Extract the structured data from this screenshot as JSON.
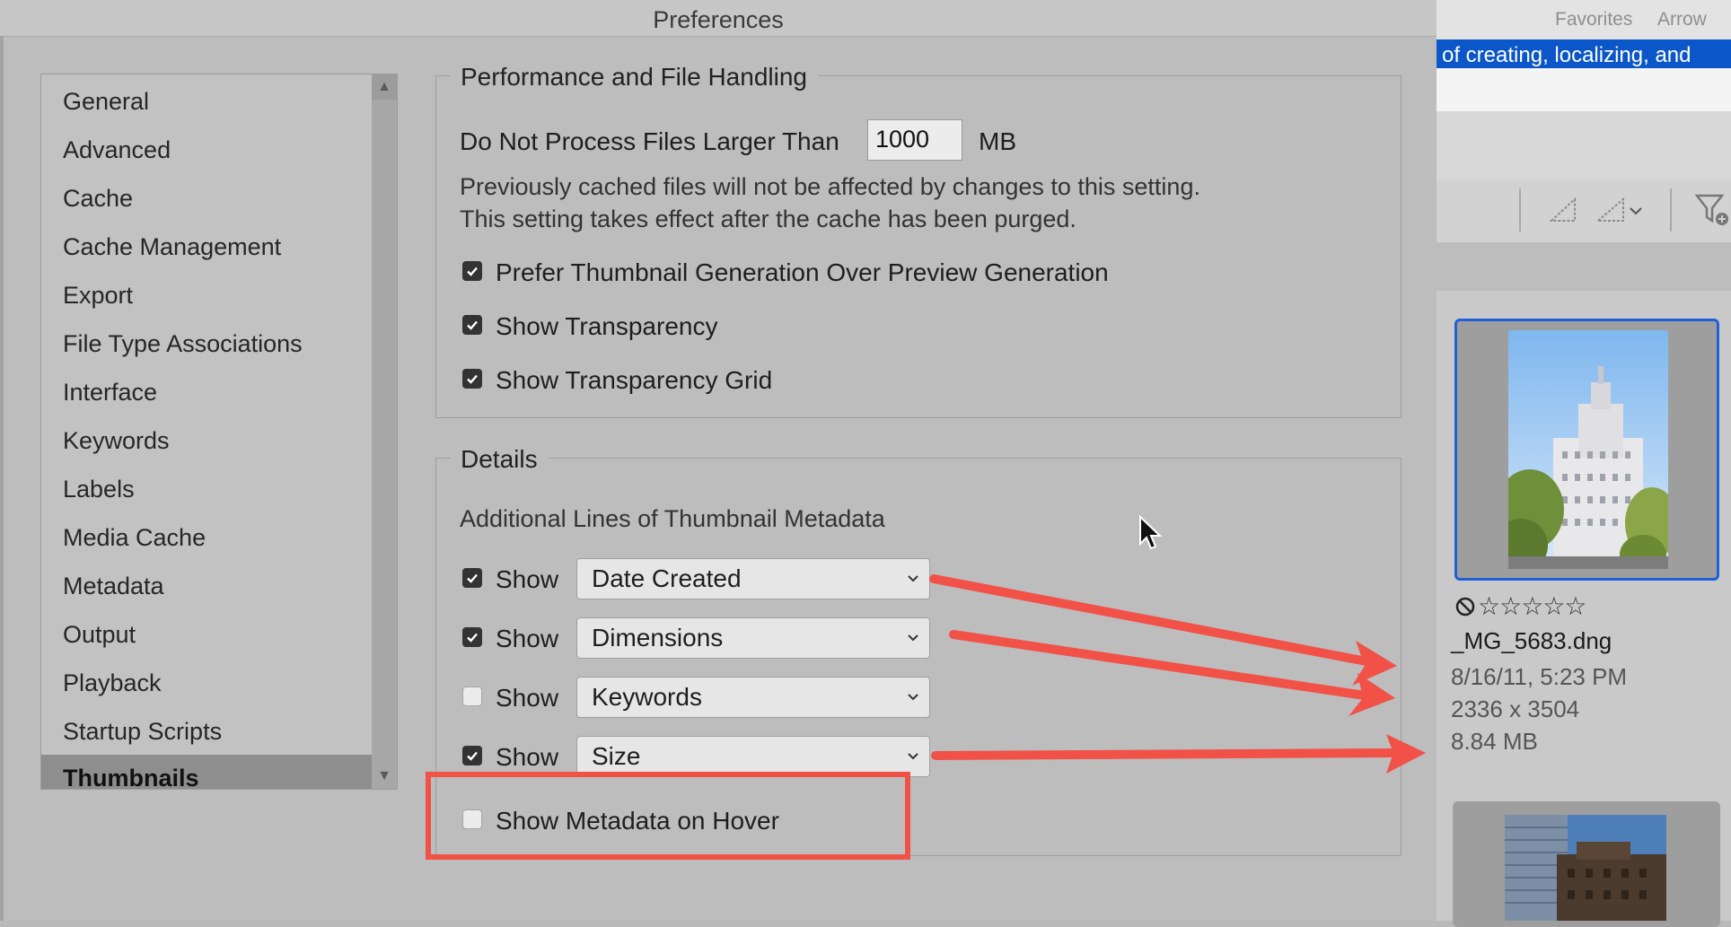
{
  "window": {
    "title": "Preferences"
  },
  "sidebar": {
    "items": [
      {
        "label": "General"
      },
      {
        "label": "Advanced"
      },
      {
        "label": "Cache"
      },
      {
        "label": "Cache Management"
      },
      {
        "label": "Export"
      },
      {
        "label": "File Type Associations"
      },
      {
        "label": "Interface"
      },
      {
        "label": "Keywords"
      },
      {
        "label": "Labels"
      },
      {
        "label": "Media Cache"
      },
      {
        "label": "Metadata"
      },
      {
        "label": "Output"
      },
      {
        "label": "Playback"
      },
      {
        "label": "Startup Scripts"
      },
      {
        "label": "Thumbnails"
      }
    ],
    "selected": "Thumbnails"
  },
  "performance": {
    "legend": "Performance and File Handling",
    "max_size_label": "Do Not Process Files Larger Than",
    "max_size_value": "1000",
    "max_size_unit": "MB",
    "note_line1": "Previously cached files will not be affected by changes to this setting.",
    "note_line2": "This setting takes effect after the cache has been purged.",
    "options": [
      {
        "label": "Prefer Thumbnail Generation Over Preview Generation",
        "checked": true
      },
      {
        "label": "Show Transparency",
        "checked": true
      },
      {
        "label": "Show Transparency Grid",
        "checked": true
      }
    ]
  },
  "details": {
    "legend": "Details",
    "subtitle": "Additional Lines of Thumbnail Metadata",
    "rows": [
      {
        "show_label": "Show",
        "checked": true,
        "selected": "Date Created"
      },
      {
        "show_label": "Show",
        "checked": true,
        "selected": "Dimensions"
      },
      {
        "show_label": "Show",
        "checked": false,
        "selected": "Keywords"
      },
      {
        "show_label": "Show",
        "checked": true,
        "selected": "Size"
      }
    ],
    "hover_option": {
      "label": "Show Metadata on Hover",
      "checked": false
    }
  },
  "right_panel": {
    "tabs": [
      {
        "label": "Favorites"
      },
      {
        "label": "Arrow"
      }
    ],
    "banner_text": "of creating, localizing, and",
    "thumbnail": {
      "rating": "☆☆☆☆☆",
      "filename": "_MG_5683.dng",
      "date": "8/16/11, 5:23 PM",
      "dimensions": "2336 x 3504",
      "size": "8.84 MB"
    }
  },
  "colors": {
    "annotation_red": "#f15147",
    "selection_blue": "#1f5fd8",
    "banner_blue": "#0b56c8",
    "sidebar_selected": "#8e8e8e"
  },
  "icons": {
    "checkbox_checked": "checkmark-icon",
    "dropdown": "chevron-down-icon",
    "reject": "reject-icon",
    "filter": "filter-icon",
    "mouse": "mouse-pointer-icon"
  }
}
